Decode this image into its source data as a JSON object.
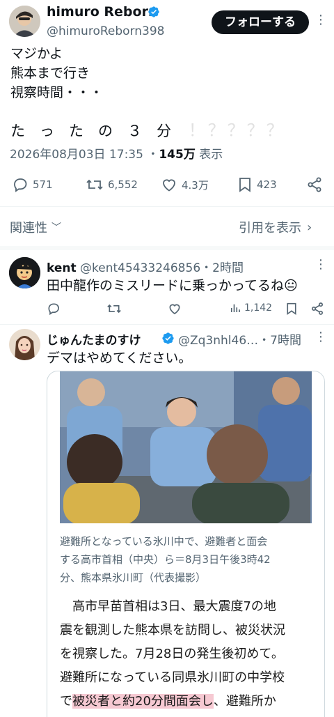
{
  "main_tweet": {
    "author_name": "himuro Reborn",
    "author_handle": "@himuroReborn398",
    "follow_label": "フォローする",
    "text_lines": [
      "マジかよ",
      "熊本まで行き",
      "視察時間・・・"
    ],
    "punch_line": "た　っ　た　の　３　分",
    "punch_marks": "！？？？？",
    "date": "2026年08月03日 17:35",
    "views_count": "145万",
    "views_label": "表示",
    "replies": "571",
    "retweets": "6,552",
    "likes": "4.3万",
    "bookmarks": "423"
  },
  "replies_header": {
    "sort_label": "関連性",
    "quotes_label": "引用を表示"
  },
  "reply1": {
    "author_name": "kent",
    "author_handle": "@kent45433246856",
    "time": "・2時間",
    "text": "田中龍作のミスリードに乗っかってるね😐",
    "views": "1,142"
  },
  "reply2": {
    "author_name": "じゅんたまのすけ",
    "author_handle": "@Zq3nhl46…",
    "time": "・7時間",
    "text": "デマはやめてください。",
    "caption_lines": [
      "避難所となっている氷川中で、避難者と面会",
      "する高市首相（中央）ら＝8月3日午後3時42",
      "分、熊本県氷川町（代表撮影）"
    ],
    "article_lines": [
      "　高市早苗首相は3日、最大震度7の地",
      "震を観測した熊本県を訪問し、被災状況",
      "を視察した。7月28日の発生後初めて。",
      "避難所になっている同県氷川町の中学校"
    ],
    "article_last_prefix": "で",
    "article_highlight": "被災者と約20分間面会し",
    "article_last_suffix": "、避難所か"
  },
  "colors": {
    "verified": "#1d9bf0",
    "highlight": "#f6c9d2",
    "muted": "#536471"
  }
}
